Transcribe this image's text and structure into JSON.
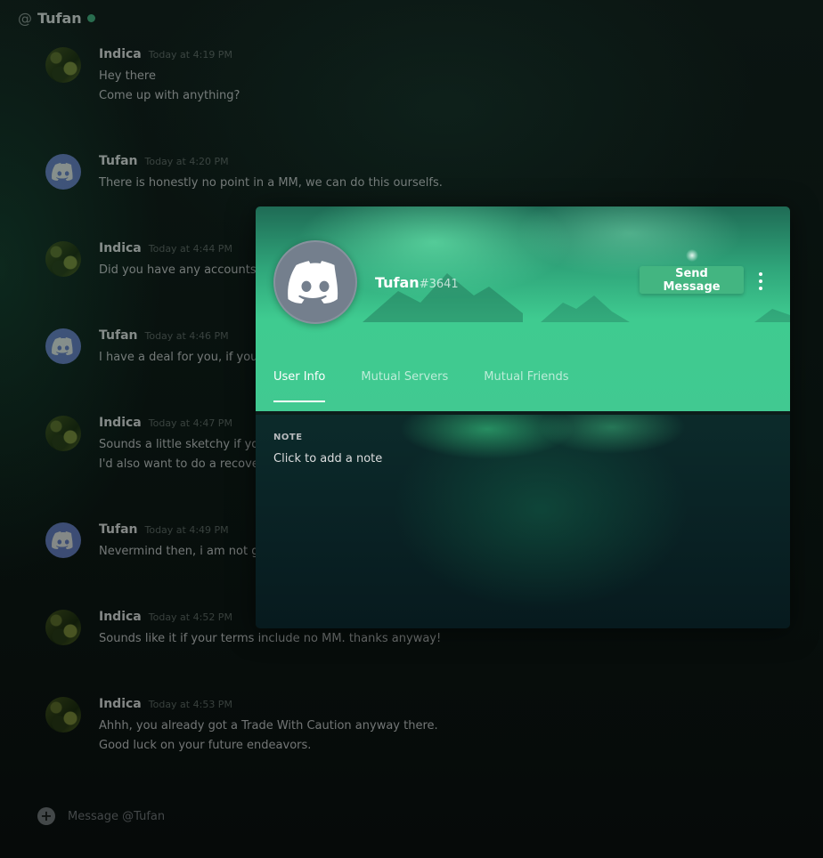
{
  "channel": {
    "at": "@",
    "name": "Tufan",
    "status_color": "#43b581"
  },
  "messages": [
    {
      "author": "Indica",
      "timestamp": "Today at 4:19 PM",
      "lines": [
        "Hey there",
        "Come up with anything?"
      ]
    },
    {
      "author": "Tufan",
      "timestamp": "Today at 4:20 PM",
      "lines": [
        "There is honestly no point in a MM, we can do this ourselfs."
      ]
    },
    {
      "author": "Indica",
      "timestamp": "Today at 4:44 PM",
      "lines": [
        "Did you have any accounts y"
      ]
    },
    {
      "author": "Tufan",
      "timestamp": "Today at 4:46 PM",
      "lines": [
        "I have a deal for you, if your"
      ]
    },
    {
      "author": "Indica",
      "timestamp": "Today at 4:47 PM",
      "lines": [
        "Sounds a little sketchy if you",
        "I'd also want to do a recover"
      ]
    },
    {
      "author": "Tufan",
      "timestamp": "Today at 4:49 PM",
      "lines": [
        "Nevermind then, i am not go"
      ]
    },
    {
      "author": "Indica",
      "timestamp": "Today at 4:52 PM",
      "lines": [
        "Sounds like it if your terms include no MM. thanks anyway!"
      ]
    },
    {
      "author": "Indica",
      "timestamp": "Today at 4:53 PM",
      "lines": [
        "Ahhh, you already got a Trade With Caution anyway there.",
        "Good luck on your future endeavors."
      ]
    }
  ],
  "composer": {
    "placeholder": "Message @Tufan",
    "plus_icon": "+"
  },
  "profile": {
    "username": "Tufan",
    "discriminator": "#3641",
    "send_message_label": "Send Message",
    "tabs": [
      "User Info",
      "Mutual Servers",
      "Mutual Friends"
    ],
    "active_tab": "User Info",
    "note_label": "NOTE",
    "note_placeholder": "Click to add a note",
    "accent_color": "#43b581"
  }
}
